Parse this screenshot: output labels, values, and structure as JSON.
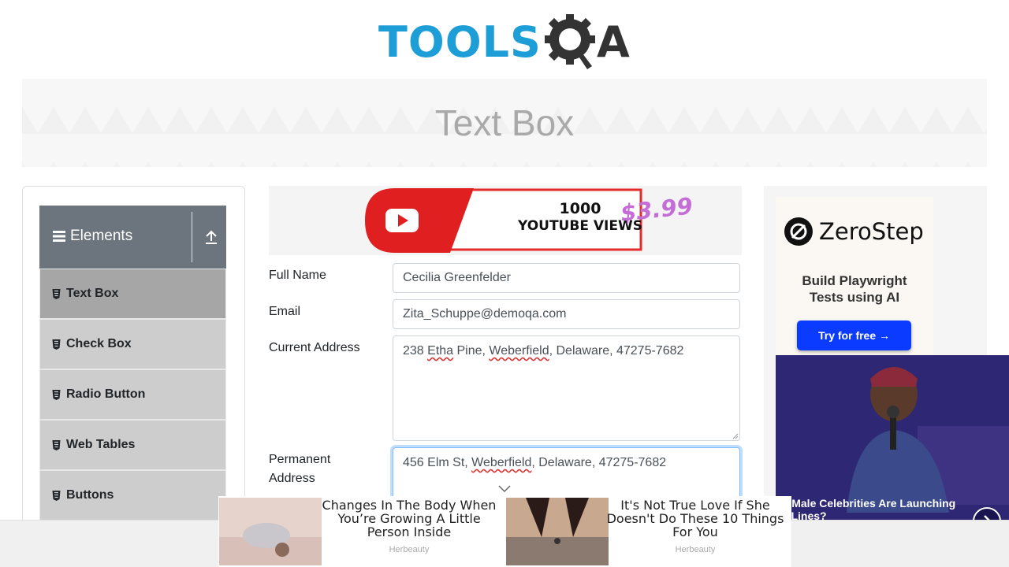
{
  "header": {
    "logo_text_primary": "TOOLS",
    "logo_text_secondary": "A",
    "logo_icon": "gear-magnifier-icon"
  },
  "banner": {
    "title": "Text Box"
  },
  "sidebar": {
    "group_title": "Elements",
    "group_icon": "hamburger-icon",
    "toggle_icon": "collapse-arrow-icon",
    "items": [
      {
        "label": "Text Box",
        "active": true
      },
      {
        "label": "Check Box",
        "active": false
      },
      {
        "label": "Radio Button",
        "active": false
      },
      {
        "label": "Web Tables",
        "active": false
      },
      {
        "label": "Buttons",
        "active": false
      }
    ]
  },
  "top_ad": {
    "line1": "1000",
    "line2": "YOUTUBE VIEWS",
    "price": "$3.99"
  },
  "form": {
    "full_name_label": "Full Name",
    "full_name_value": "Cecilia Greenfelder",
    "email_label": "Email",
    "email_value": "Zita_Schuppe@demoqa.com",
    "current_address_label": "Current Address",
    "current_address_parts": [
      "238 ",
      "Etha",
      " Pine, ",
      "Weberfield",
      ", Delaware, 47275-7682"
    ],
    "permanent_address_label_1": "Permanent",
    "permanent_address_label_2": "Address",
    "permanent_address_parts": [
      "456 Elm St, ",
      "Weberfield",
      ", Delaware, 47275-7682"
    ]
  },
  "right_ad": {
    "brand": "ZeroStep",
    "tagline_1": "Build Playwright",
    "tagline_2": "Tests using AI",
    "cta": "Try for free →"
  },
  "video_ad": {
    "caption_1": "hy Male Celebrities Are Launching",
    "caption_2": "ail Lines?"
  },
  "bottom_ads": [
    {
      "text": "Changes In The Body When You’re Growing A Little Person Inside",
      "source": "Herbeauty"
    },
    {
      "text": "It's Not True Love If She Doesn't Do These 10 Things For You",
      "source": "Herbeauty"
    }
  ],
  "colors": {
    "logo_blue": "#1e9ed7",
    "sidebar_header": "#6c757d",
    "menu_item": "#cdcdcd",
    "menu_item_active": "#a6a6a6",
    "focus_border": "#80bdff",
    "cta_blue": "#0b3bff"
  }
}
